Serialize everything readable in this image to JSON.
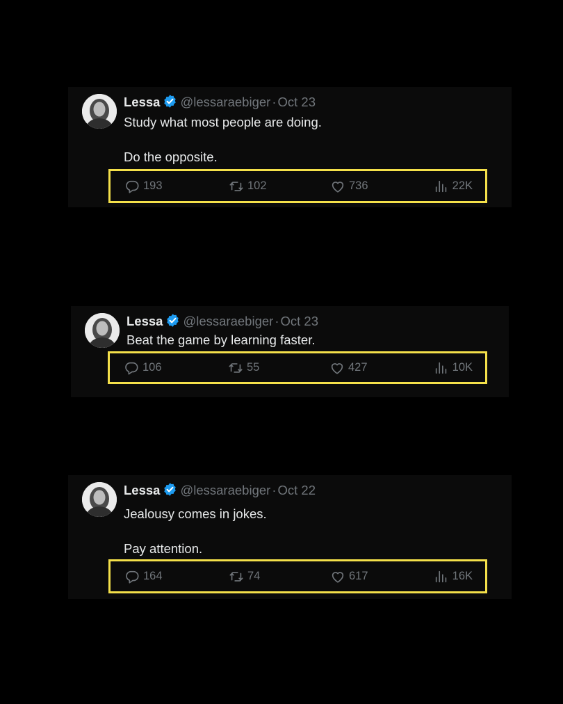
{
  "colors": {
    "background": "#000000",
    "card": "#0b0b0b",
    "text": "#e7e9ea",
    "muted": "#71767b",
    "verified": "#1d9bf0",
    "highlight_border": "#f4e04a"
  },
  "icons": {
    "reply": "speech-bubble-icon",
    "retweet": "retweet-arrows-icon",
    "like": "heart-icon",
    "views": "bar-chart-icon",
    "verified": "verified-badge-icon"
  },
  "tweets": [
    {
      "name": "Lessa",
      "handle": "@lessaraebiger",
      "separator": "·",
      "date": "Oct 23",
      "lines": [
        "Study what most people are doing.",
        "Do the opposite."
      ],
      "replies": "193",
      "retweets": "102",
      "likes": "736",
      "views": "22K"
    },
    {
      "name": "Lessa",
      "handle": "@lessaraebiger",
      "separator": "·",
      "date": "Oct 23",
      "lines": [
        "Beat the game by learning faster."
      ],
      "replies": "106",
      "retweets": "55",
      "likes": "427",
      "views": "10K"
    },
    {
      "name": "Lessa",
      "handle": "@lessaraebiger",
      "separator": "·",
      "date": "Oct 22",
      "lines": [
        "Jealousy comes in jokes.",
        "Pay attention."
      ],
      "replies": "164",
      "retweets": "74",
      "likes": "617",
      "views": "16K"
    }
  ]
}
